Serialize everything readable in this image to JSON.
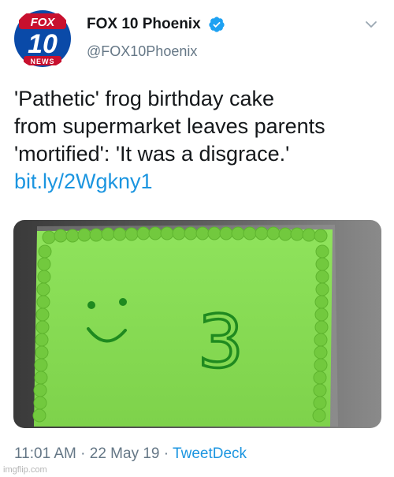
{
  "author": {
    "name": "FOX 10 Phoenix",
    "handle": "@FOX10Phoenix",
    "avatar_logo_text": [
      "FOX",
      "10",
      "NEWS"
    ],
    "verified": true,
    "verified_icon": "verified-badge-icon",
    "menu_icon": "chevron-down-icon"
  },
  "tweet": {
    "text_lines": [
      "'Pathetic' frog birthday cake",
      "from supermarket leaves parents",
      "'mortified': 'It was a disgrace.'"
    ],
    "link": "bit.ly/2Wgkny1",
    "media": {
      "description_icon": "cake-photo",
      "cake_writing": "3"
    },
    "time": "11:01 AM",
    "separator": "·",
    "date": "22 May 19",
    "source": "TweetDeck"
  },
  "watermark": "imgflip.com",
  "colors": {
    "link_blue": "#1b95e0",
    "muted_gray": "#657786",
    "text_dark": "#14171a",
    "fox_red": "#c8102e",
    "fox_blue": "#003b8e",
    "icing_green": "#86dc50",
    "piping_green": "#1f8a1f"
  }
}
